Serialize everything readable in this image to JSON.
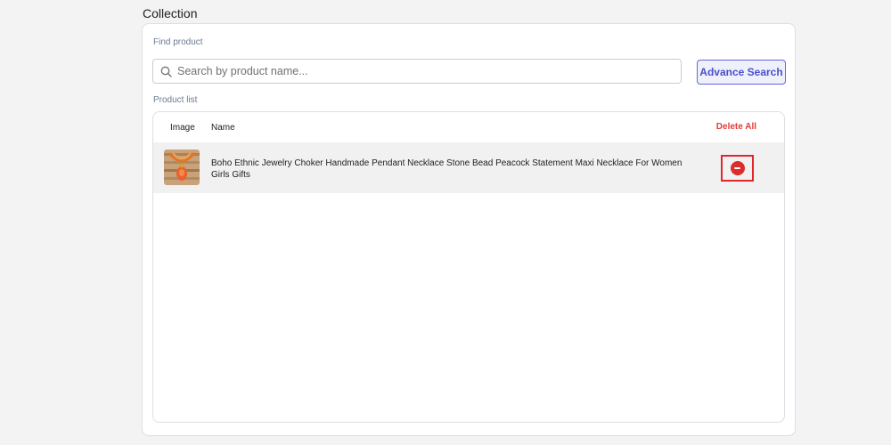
{
  "section": {
    "title": "Collection"
  },
  "find": {
    "label": "Find product",
    "placeholder": "Search by product name...",
    "value": "",
    "icon": "search-icon",
    "advance_button": "Advance Search"
  },
  "list": {
    "label": "Product list",
    "columns": {
      "image": "Image",
      "name": "Name"
    },
    "delete_all": "Delete All",
    "items": [
      {
        "name": "Boho Ethnic Jewelry Choker Handmade Pendant Necklace Stone Bead Peacock Statement Maxi Necklace For Women Girls Gifts",
        "image": "necklace-thumbnail",
        "remove_icon": "minus-circle-icon"
      }
    ]
  },
  "colors": {
    "accent": "#4b4fc9",
    "danger": "#e03c3c",
    "row_bg": "#f1f1f2"
  }
}
